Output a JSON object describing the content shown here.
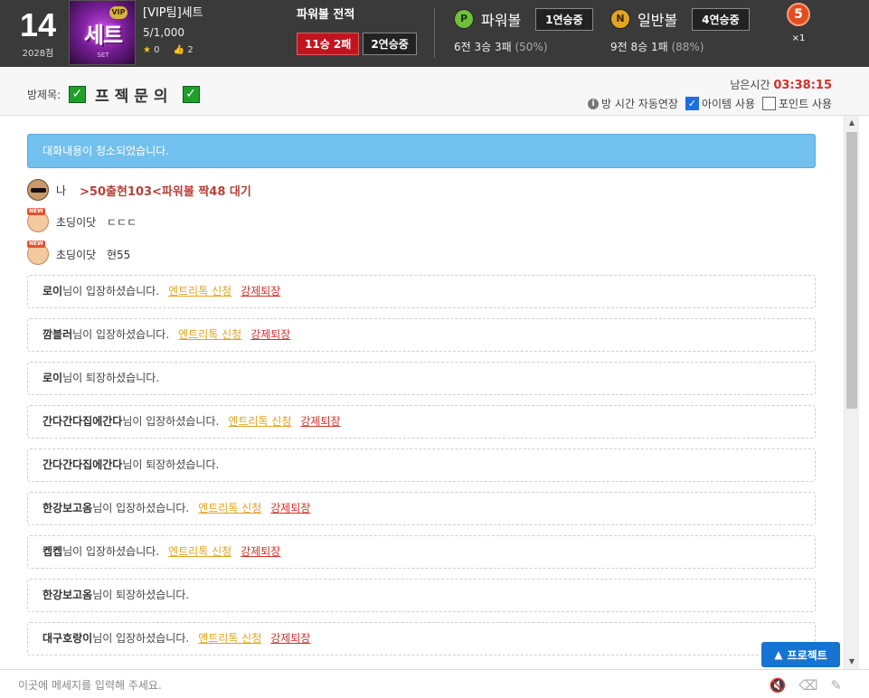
{
  "header": {
    "level": "14",
    "points": "2028점",
    "room_thumb": {
      "vip": "VIP",
      "big_text": "세트",
      "tag": "SET"
    },
    "room_title": "[VIP팀]세트",
    "room_count": "5/1,000",
    "stars": "0",
    "likes": "2",
    "record_label": "파워볼 전적",
    "record_main": "11승 2패",
    "record_streak": "2연승중",
    "power": {
      "icon": "P",
      "name": "파워볼",
      "streak": "1연승중",
      "sub_a": "6전 3승 3패",
      "sub_pct": "(50%)"
    },
    "normal": {
      "icon": "N",
      "name": "일반볼",
      "streak": "4연승중",
      "sub_a": "9전 8승 1패",
      "sub_pct": "(88%)"
    },
    "badge_num": "5",
    "badge_mult": "×1"
  },
  "subbar": {
    "label": "방제목:",
    "check": "✓",
    "room_name": "프젝문의",
    "remain_label": "남은시간",
    "remain_time": "03:38:15",
    "info_icon": "i",
    "opt_auto": "방 시간 자동연장",
    "opt_item": "아이템 사용",
    "opt_point": "포인트 사용",
    "check_mark": "✓"
  },
  "chat": {
    "notice": "대화내용이 청소되었습니다.",
    "messages": [
      {
        "nick": "나",
        "text": ">50출현103<파워볼 짝48 대기"
      },
      {
        "nick": "초딩이닷",
        "text": "ㄷㄷㄷ",
        "new": "NEW"
      },
      {
        "nick": "초딩이닷",
        "text": "현55",
        "new": "NEW"
      }
    ],
    "system": [
      {
        "name": "로이",
        "text": "님이 입장하셨습니다.",
        "entry": "엔트리톡 신청",
        "kick": "강제퇴장"
      },
      {
        "name": "깜블러",
        "text": "님이 입장하셨습니다.",
        "entry": "엔트리톡 신청",
        "kick": "강제퇴장"
      },
      {
        "name": "로이",
        "text": "님이 퇴장하셨습니다."
      },
      {
        "name": "간다간다집에간다",
        "text": "님이 입장하셨습니다.",
        "entry": "엔트리톡 신청",
        "kick": "강제퇴장"
      },
      {
        "name": "간다간다집에간다",
        "text": "님이 퇴장하셨습니다."
      },
      {
        "name": "한강보고옴",
        "text": "님이 입장하셨습니다.",
        "entry": "엔트리톡 신청",
        "kick": "강제퇴장"
      },
      {
        "name": "켑켑",
        "text": "님이 입장하셨습니다.",
        "entry": "엔트리톡 신청",
        "kick": "강제퇴장"
      },
      {
        "name": "한강보고옴",
        "text": "님이 퇴장하셨습니다."
      },
      {
        "name": "대구호랑이",
        "text": "님이 입장하셨습니다.",
        "entry": "엔트리톡 신청",
        "kick": "강제퇴장"
      }
    ]
  },
  "project_button": "프로젝트",
  "input": {
    "placeholder": "이곳에 메세지를 입력해 주세요."
  }
}
